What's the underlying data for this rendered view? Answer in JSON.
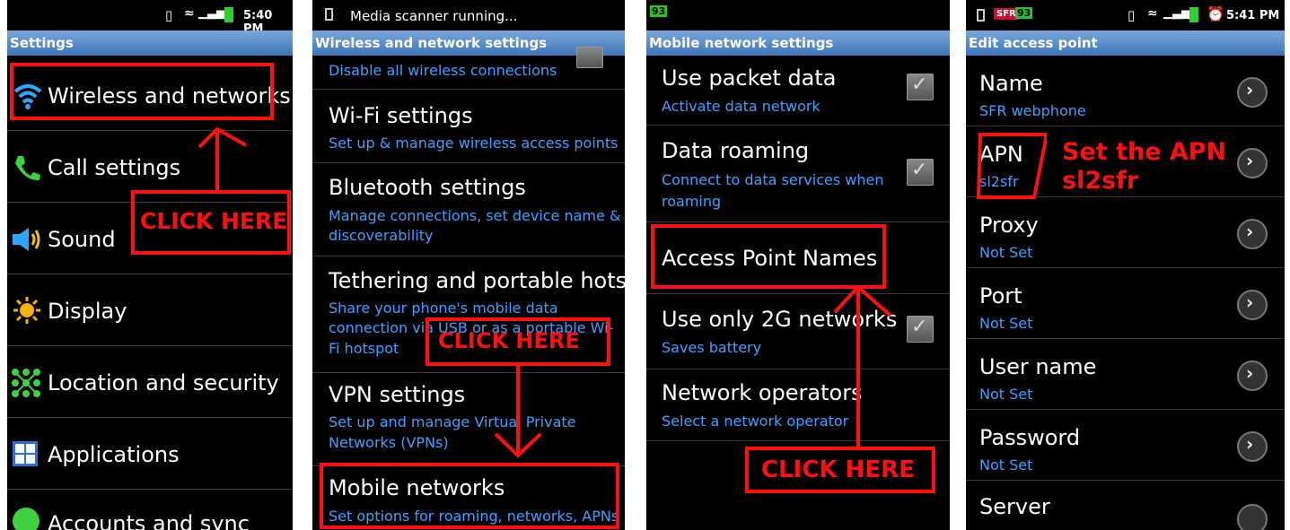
{
  "p1": {
    "status_time": "5:40 PM",
    "title": "Settings",
    "items": [
      "Wireless and networks",
      "Call settings",
      "Sound",
      "Display",
      "Location and security",
      "Applications",
      "Accounts and sync"
    ],
    "callout": "CLICK HERE"
  },
  "p2": {
    "status": "Media scanner running...",
    "title": "Wireless and network settings",
    "top_summary": "Disable all wireless connections",
    "items": [
      {
        "title": "Wi-Fi settings",
        "summary": "Set up & manage wireless access points"
      },
      {
        "title": "Bluetooth settings",
        "summary": "Manage connections, set device name &",
        "summary2": "discoverability"
      },
      {
        "title": "Tethering and portable hotsp",
        "summary": "Share your phone's mobile data",
        "summary2": "connection via USB or as a portable Wi-",
        "summary3": "Fi hotspot"
      },
      {
        "title": "VPN settings",
        "summary": "Set up and manage Virtual Private",
        "summary2": "Networks (VPNs)"
      },
      {
        "title": "Mobile networks",
        "summary": "Set options for roaming, networks, APNs"
      }
    ],
    "callout": "CLICK HERE"
  },
  "p3": {
    "badge": "93",
    "title": "Mobile network settings",
    "items": [
      {
        "title": "Use packet data",
        "summary": "Activate data network"
      },
      {
        "title": "Data roaming",
        "summary": "Connect to data services when",
        "summary2": "roaming"
      },
      {
        "title": "Access Point Names"
      },
      {
        "title": "Use only 2G networks",
        "summary": "Saves battery"
      },
      {
        "title": "Network operators",
        "summary": "Select a network operator"
      }
    ],
    "callout": "CLICK HERE"
  },
  "p4": {
    "carrier": "SFR",
    "badge": "93",
    "status_time": "5:41 PM",
    "title": "Edit access point",
    "items": [
      {
        "title": "Name",
        "value": "SFR webphone"
      },
      {
        "title": "APN",
        "value": "sl2sfr"
      },
      {
        "title": "Proxy",
        "value": "Not Set"
      },
      {
        "title": "Port",
        "value": "Not Set"
      },
      {
        "title": "User name",
        "value": "Not Set"
      },
      {
        "title": "Password",
        "value": "Not Set"
      },
      {
        "title": "Server"
      }
    ],
    "callout_line1": "Set the APN",
    "callout_line2": "sl2sfr"
  },
  "colors": {
    "accent_red": "#ff1010",
    "summary_blue": "#3fa0ff",
    "title_bar": "#3d75b8"
  }
}
